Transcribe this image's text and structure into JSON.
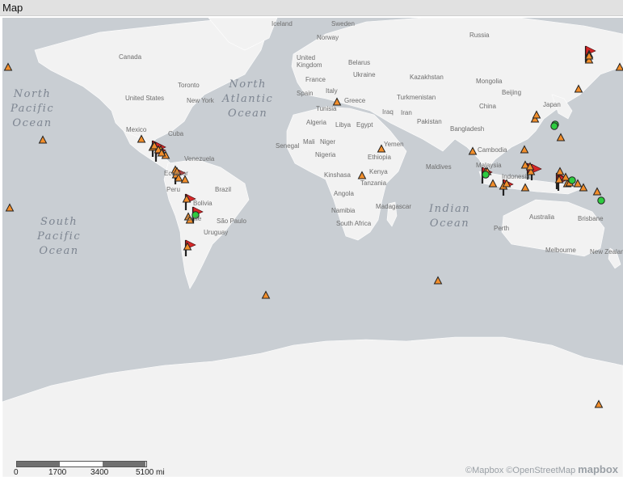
{
  "window": {
    "title": "Map"
  },
  "colors": {
    "water": "#c9ced3",
    "land": "#f2f2f2",
    "volcano": "#f28e2b",
    "flag": "#d62728",
    "dot": "#2ecc40"
  },
  "ocean_labels": {
    "north_pacific": "North\nPacific\nOcean",
    "north_atlantic": "North\nAtlantic\nOcean",
    "south_pacific": "South\nPacific\nOcean",
    "indian": "Indian\nOcean"
  },
  "place_labels": {
    "iceland": "Iceland",
    "sweden": "Sweden",
    "norway": "Norway",
    "russia": "Russia",
    "canada": "Canada",
    "united_kingdom": "United\nKingdom",
    "belarus": "Belarus",
    "ukraine": "Ukraine",
    "kazakhstan": "Kazakhstan",
    "mongolia": "Mongolia",
    "france": "France",
    "spain": "Spain",
    "italy": "Italy",
    "greece": "Greece",
    "turkmenistan": "Turkmenistan",
    "beijing": "Beijing",
    "japan": "Japan",
    "toronto": "Toronto",
    "new_york": "New York",
    "united_states": "United States",
    "tunisia": "Tunisia",
    "iraq": "Iraq",
    "iran": "Iran",
    "china": "China",
    "algeria": "Algeria",
    "libya": "Libya",
    "egypt": "Egypt",
    "pakistan": "Pakistan",
    "mexico": "Mexico",
    "cuba": "Cuba",
    "bangladesh": "Bangladesh",
    "senegal": "Senegal",
    "mali": "Mali",
    "niger": "Niger",
    "yemen": "Yemen",
    "cambodia": "Cambodia",
    "nigeria": "Nigeria",
    "ethiopia": "Ethiopia",
    "venezuela": "Venezuela",
    "ecuador": "Ecuador",
    "malaysia": "Malaysia",
    "kenya": "Kenya",
    "kinshasa": "Kinshasa",
    "maldives": "Maldives",
    "indonesia": "Indonesia",
    "peru": "Peru",
    "brazil": "Brazil",
    "tanzania": "Tanzania",
    "angola": "Angola",
    "bolivia": "Bolivia",
    "namibia": "Namibia",
    "madagascar": "Madagascar",
    "australia": "Australia",
    "chile": "Chile",
    "sao_paulo": "São Paulo",
    "brisbane": "Brisbane",
    "uruguay": "Uruguay",
    "south_africa": "South Africa",
    "perth": "Perth",
    "melbourne": "Melbourne",
    "new_zealand": "New Zealand"
  },
  "scale": {
    "ticks": [
      "0",
      "1700",
      "3400",
      "5100 mi"
    ]
  },
  "attribution": {
    "text": "©Mapbox ©OpenStreetMap",
    "logo": "mapbox"
  },
  "markers": {
    "volcano_count": 52,
    "flag_count": 14,
    "dot_count": 6
  }
}
